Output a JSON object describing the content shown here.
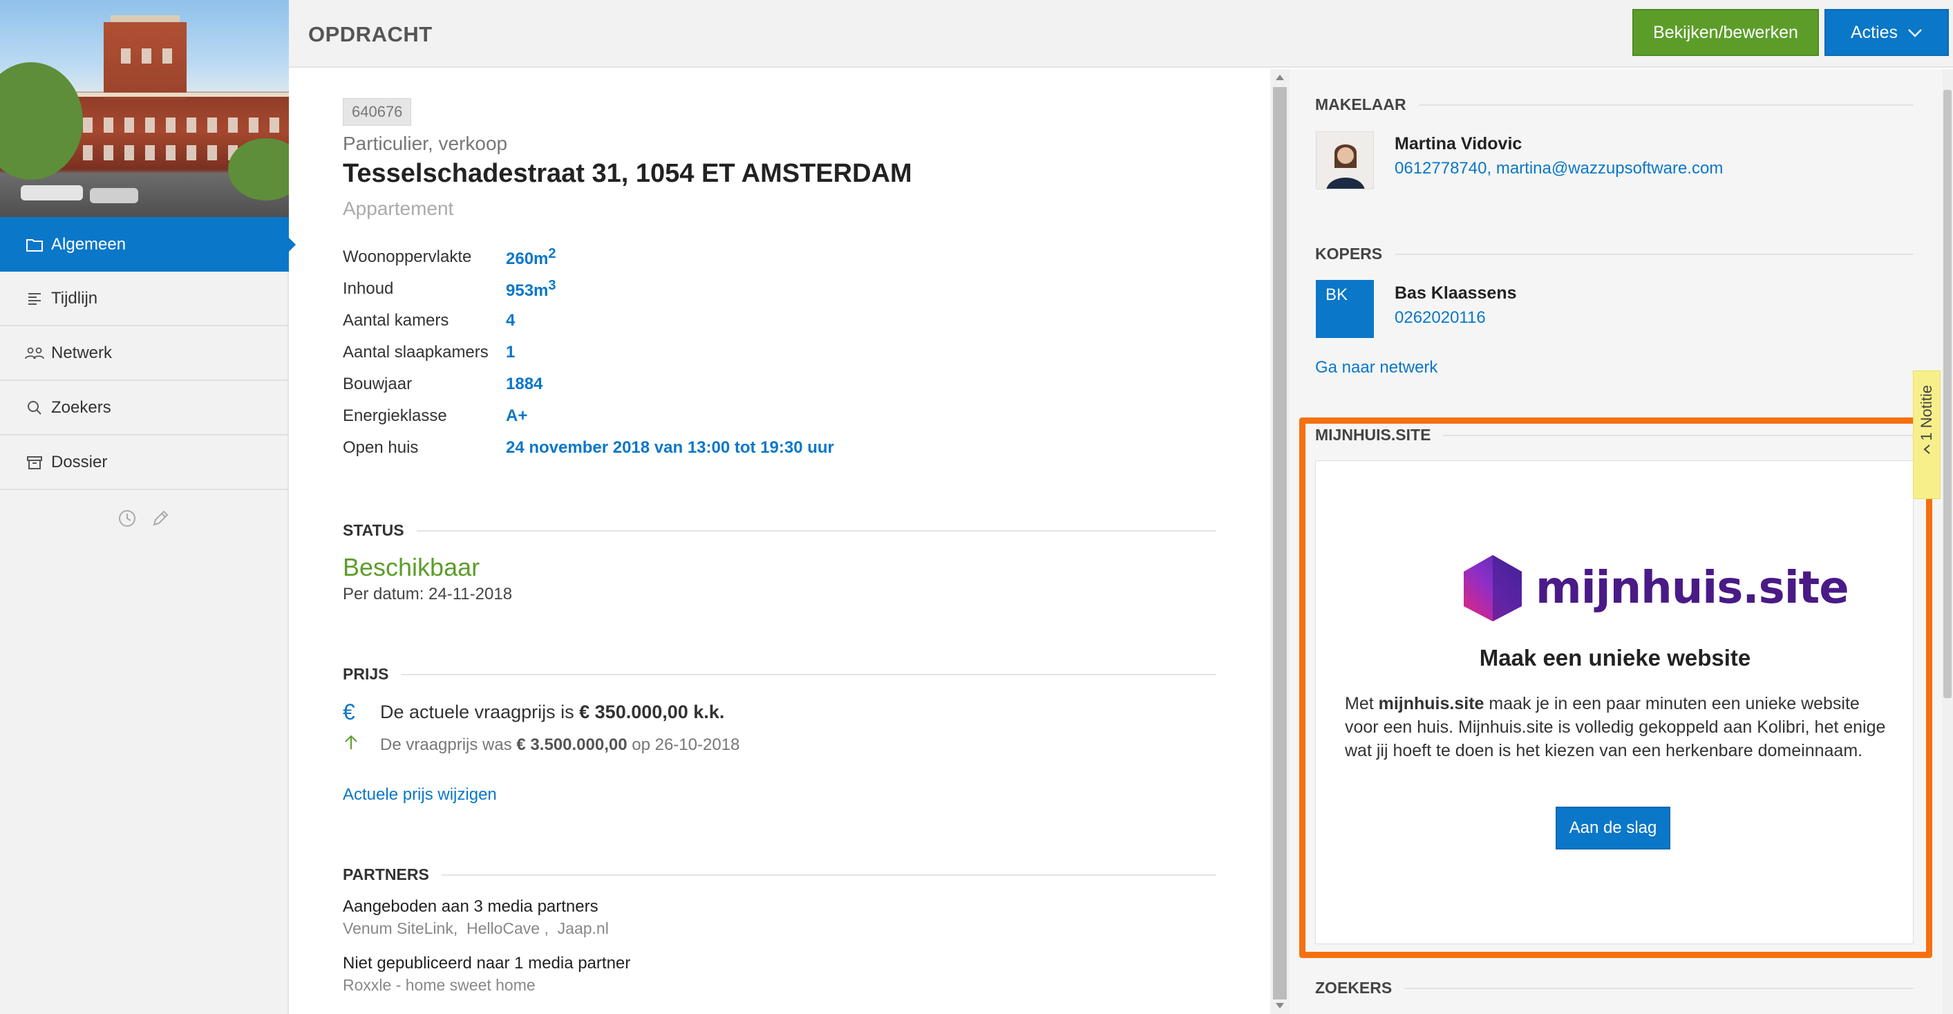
{
  "sidebar": {
    "items": [
      {
        "label": "Algemeen",
        "icon": "folder-icon",
        "active": true
      },
      {
        "label": "Tijdlijn",
        "icon": "list-icon",
        "active": false
      },
      {
        "label": "Netwerk",
        "icon": "people-icon",
        "active": false
      },
      {
        "label": "Zoekers",
        "icon": "search-icon",
        "active": false
      },
      {
        "label": "Dossier",
        "icon": "archive-icon",
        "active": false
      }
    ],
    "tools": [
      "history-icon",
      "edit-icon"
    ]
  },
  "header": {
    "title": "OPDRACHT",
    "edit_label": "Bekijken/bewerken",
    "actions_label": "Acties"
  },
  "object": {
    "id": "640676",
    "type": "Particulier, verkoop",
    "address": "Tesselschadestraat 31, 1054 ET AMSTERDAM",
    "kind": "Appartement",
    "properties": [
      {
        "label": "Woonoppervlakte",
        "value": "260m",
        "sup": "2"
      },
      {
        "label": "Inhoud",
        "value": "953m",
        "sup": "3"
      },
      {
        "label": "Aantal kamers",
        "value": "4",
        "sup": ""
      },
      {
        "label": "Aantal slaapkamers",
        "value": "1",
        "sup": ""
      },
      {
        "label": "Bouwjaar",
        "value": "1884",
        "sup": ""
      },
      {
        "label": "Energieklasse",
        "value": "A+",
        "sup": ""
      },
      {
        "label": "Open huis",
        "value": "24 november 2018 van 13:00 tot 19:30 uur",
        "sup": ""
      }
    ]
  },
  "status": {
    "heading": "STATUS",
    "value": "Beschikbaar",
    "date": "Per datum: 24-11-2018"
  },
  "price": {
    "heading": "PRIJS",
    "current_prefix": "De actuele vraagprijs is ",
    "current_value": "€ 350.000,00 k.k.",
    "was_prefix": "De vraagprijs was ",
    "was_value": "€ 3.500.000,00",
    "was_suffix": " op 26-10-2018",
    "edit_link": "Actuele prijs wijzigen"
  },
  "partners": {
    "heading": "PARTNERS",
    "offered_title": "Aangeboden aan 3 media partners",
    "offered_list": "Venum SiteLink,  HelloCave ,  Jaap.nl",
    "unpublished_title": "Niet gepubliceerd naar 1 media partner",
    "unpublished_list": "Roxxle - home sweet home"
  },
  "agent": {
    "heading": "MAKELAAR",
    "name": "Martina Vidovic",
    "phone": "0612778740,",
    "email": "martina@wazzupsoftware.com"
  },
  "buyers": {
    "heading": "KOPERS",
    "initials": "BK",
    "name": "Bas Klaassens",
    "phone": "0262020116",
    "network_link": "Ga naar netwerk"
  },
  "mijnhuis": {
    "heading": "MIJNHUIS.SITE",
    "brand": "mijnhuis.site",
    "title": "Maak een unieke website",
    "text_prefix": "Met ",
    "text_bold": "mijnhuis.site",
    "text_rest": " maak je in een paar minuten een unieke website voor een huis. Mijnhuis.site is volledig gekoppeld aan Kolibri, het enige wat jij hoeft te doen is het kiezen van een herkenbare domeinnaam.",
    "button_label": "Aan de slag"
  },
  "searchers": {
    "heading": "ZOEKERS"
  },
  "notice_tab": {
    "label": "Notitie",
    "count": "1"
  },
  "colors": {
    "primary": "#0a77c8",
    "success": "#5c9d2a",
    "highlight": "#f5700f",
    "note": "#f7f08a",
    "brand_purple": "#4a1a86"
  }
}
